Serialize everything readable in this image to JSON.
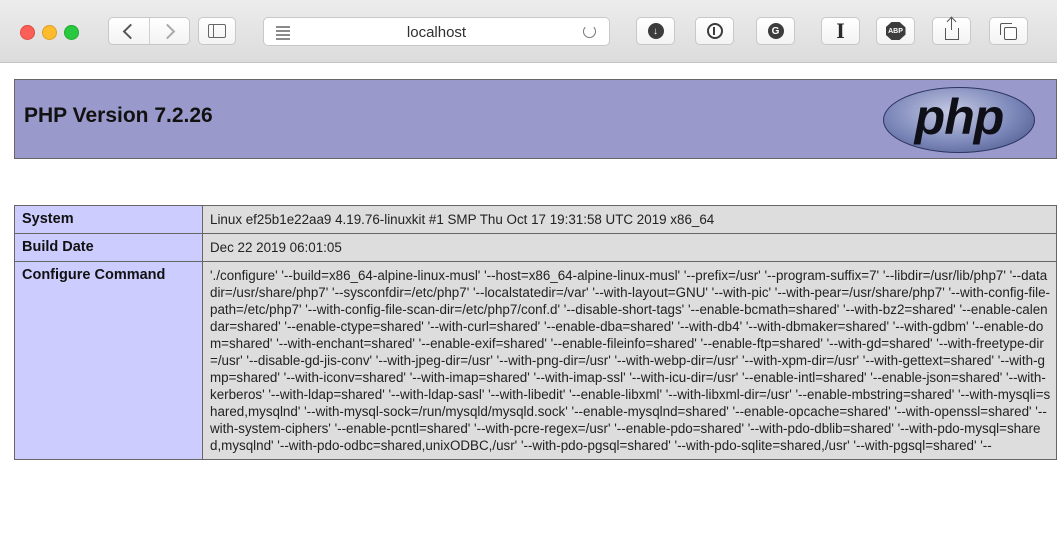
{
  "browser": {
    "url": "localhost",
    "icons": {
      "back": "chevron-left-icon",
      "forward": "chevron-right-icon",
      "sidebar": "sidebar-icon",
      "reader": "reader-icon",
      "reload": "reload-icon",
      "share": "share-icon",
      "tabs": "tabs-overview-icon"
    },
    "extensions": [
      {
        "name": "download-icon",
        "glyph": "↓"
      },
      {
        "name": "onepassword-icon",
        "glyph": ""
      },
      {
        "name": "grammarly-icon",
        "glyph": "G"
      },
      {
        "name": "instapaper-icon",
        "glyph": "I"
      },
      {
        "name": "adblock-icon",
        "glyph": "ABP"
      }
    ]
  },
  "page": {
    "title": "PHP Version 7.2.26",
    "logo_text": "php",
    "header_bg": "#9999cc",
    "label_bg": "#ccccff",
    "value_bg": "#dddddd",
    "rows": [
      {
        "label": "System",
        "value": "Linux ef25b1e22aa9 4.19.76-linuxkit #1 SMP Thu Oct 17 19:31:58 UTC 2019 x86_64"
      },
      {
        "label": "Build Date",
        "value": "Dec 22 2019 06:01:05"
      },
      {
        "label": "Configure Command",
        "value": "'./configure' '--build=x86_64-alpine-linux-musl' '--host=x86_64-alpine-linux-musl' '--prefix=/usr' '--program-suffix=7' '--libdir=/usr/lib/php7' '--datadir=/usr/share/php7' '--sysconfdir=/etc/php7' '--localstatedir=/var' '--with-layout=GNU' '--with-pic' '--with-pear=/usr/share/php7' '--with-config-file-path=/etc/php7' '--with-config-file-scan-dir=/etc/php7/conf.d' '--disable-short-tags' '--enable-bcmath=shared' '--with-bz2=shared' '--enable-calendar=shared' '--enable-ctype=shared' '--with-curl=shared' '--enable-dba=shared' '--with-db4' '--with-dbmaker=shared' '--with-gdbm' '--enable-dom=shared' '--with-enchant=shared' '--enable-exif=shared' '--enable-fileinfo=shared' '--enable-ftp=shared' '--with-gd=shared' '--with-freetype-dir=/usr' '--disable-gd-jis-conv' '--with-jpeg-dir=/usr' '--with-png-dir=/usr' '--with-webp-dir=/usr' '--with-xpm-dir=/usr' '--with-gettext=shared' '--with-gmp=shared' '--with-iconv=shared' '--with-imap=shared' '--with-imap-ssl' '--with-icu-dir=/usr' '--enable-intl=shared' '--enable-json=shared' '--with-kerberos' '--with-ldap=shared' '--with-ldap-sasl' '--with-libedit' '--enable-libxml' '--with-libxml-dir=/usr' '--enable-mbstring=shared' '--with-mysqli=shared,mysqlnd' '--with-mysql-sock=/run/mysqld/mysqld.sock' '--enable-mysqlnd=shared' '--enable-opcache=shared' '--with-openssl=shared' '--with-system-ciphers' '--enable-pcntl=shared' '--with-pcre-regex=/usr' '--enable-pdo=shared' '--with-pdo-dblib=shared' '--with-pdo-mysql=shared,mysqlnd' '--with-pdo-odbc=shared,unixODBC,/usr' '--with-pdo-pgsql=shared' '--with-pdo-sqlite=shared,/usr' '--with-pgsql=shared' '--"
      }
    ]
  }
}
